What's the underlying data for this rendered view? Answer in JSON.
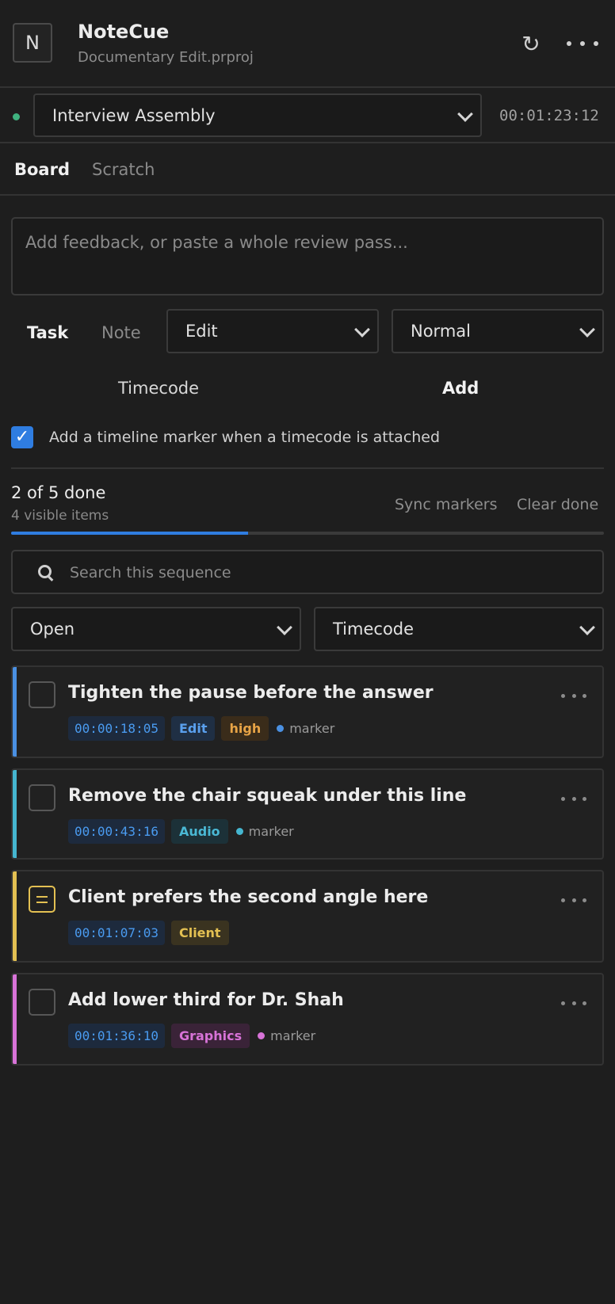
{
  "header": {
    "logo_letter": "N",
    "app_name": "NoteCue",
    "project": "Documentary Edit.prproj"
  },
  "sequence": {
    "selected": "Interview Assembly",
    "timecode": "00:01:23:12",
    "status_color": "#3fb27f"
  },
  "tabs": [
    {
      "label": "Board",
      "active": true
    },
    {
      "label": "Scratch",
      "active": false
    }
  ],
  "composer": {
    "placeholder": "Add feedback, or paste a whole review pass...",
    "kind_task": "Task",
    "kind_note": "Note",
    "category": "Edit",
    "priority": "Normal",
    "timecode_button": "Timecode",
    "add_button": "Add",
    "marker_option_label": "Add a timeline marker when a timecode is attached",
    "marker_option_checked": true
  },
  "progress": {
    "done_label": "2 of 5 done",
    "visible_label": "4 visible items",
    "sync_label": "Sync markers",
    "clear_label": "Clear done",
    "fraction": 0.4,
    "accent": "#2f7de1"
  },
  "search": {
    "placeholder": "Search this sequence"
  },
  "filters": {
    "status": "Open",
    "sort": "Timecode"
  },
  "items": [
    {
      "title": "Tighten the pause before the answer",
      "timecode": "00:00:18:05",
      "category": "Edit",
      "priority": "high",
      "marker": "marker",
      "kind": "task",
      "color": "#4a90e2"
    },
    {
      "title": "Remove the chair squeak under this line",
      "timecode": "00:00:43:16",
      "category": "Audio",
      "marker": "marker",
      "kind": "task",
      "color": "#45b6d0"
    },
    {
      "title": "Client prefers the second angle here",
      "timecode": "00:01:07:03",
      "category": "Client",
      "kind": "note",
      "color": "#e3c052"
    },
    {
      "title": "Add lower third for Dr. Shah",
      "timecode": "00:01:36:10",
      "category": "Graphics",
      "marker": "marker",
      "kind": "task",
      "color": "#d873d8"
    }
  ]
}
